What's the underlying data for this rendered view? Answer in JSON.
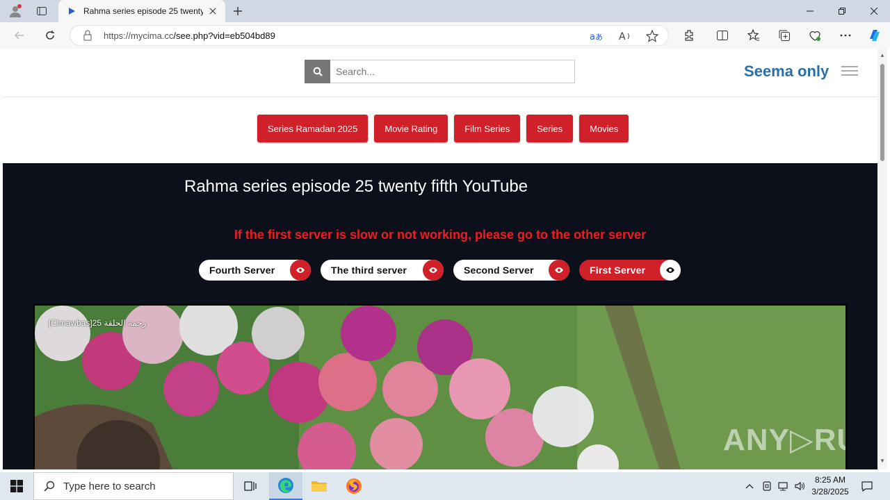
{
  "browser": {
    "tab_title": "Rahma series episode 25 twenty f",
    "url_domain": "https://mycima.cc",
    "url_path": "/see.php?vid=eb504bd89"
  },
  "site": {
    "search_placeholder": "Search...",
    "brand": "Seema only",
    "nav": [
      "Series Ramadan 2025",
      "Movie Rating",
      "Film Series",
      "Series",
      "Movies"
    ],
    "episode_title": "Rahma series episode 25 twenty fifth YouTube",
    "warning": "If the first server is slow or not working, please go to the other server",
    "servers": [
      {
        "label": "Fourth Server",
        "active": false
      },
      {
        "label": "The third server",
        "active": false
      },
      {
        "label": "Second Server",
        "active": false
      },
      {
        "label": "First Server",
        "active": true
      }
    ],
    "video_label": "[Cimawbas]25 رحمة الحلقة",
    "watermark": "ANY▷RUN"
  },
  "taskbar": {
    "search_placeholder": "Type here to search",
    "time": "8:25 AM",
    "date": "3/28/2025"
  },
  "colors": {
    "accent_red": "#d0202a",
    "warning_red": "#ee1d23",
    "brand_blue": "#2b6fa6",
    "dark_bg": "#0b101b"
  }
}
